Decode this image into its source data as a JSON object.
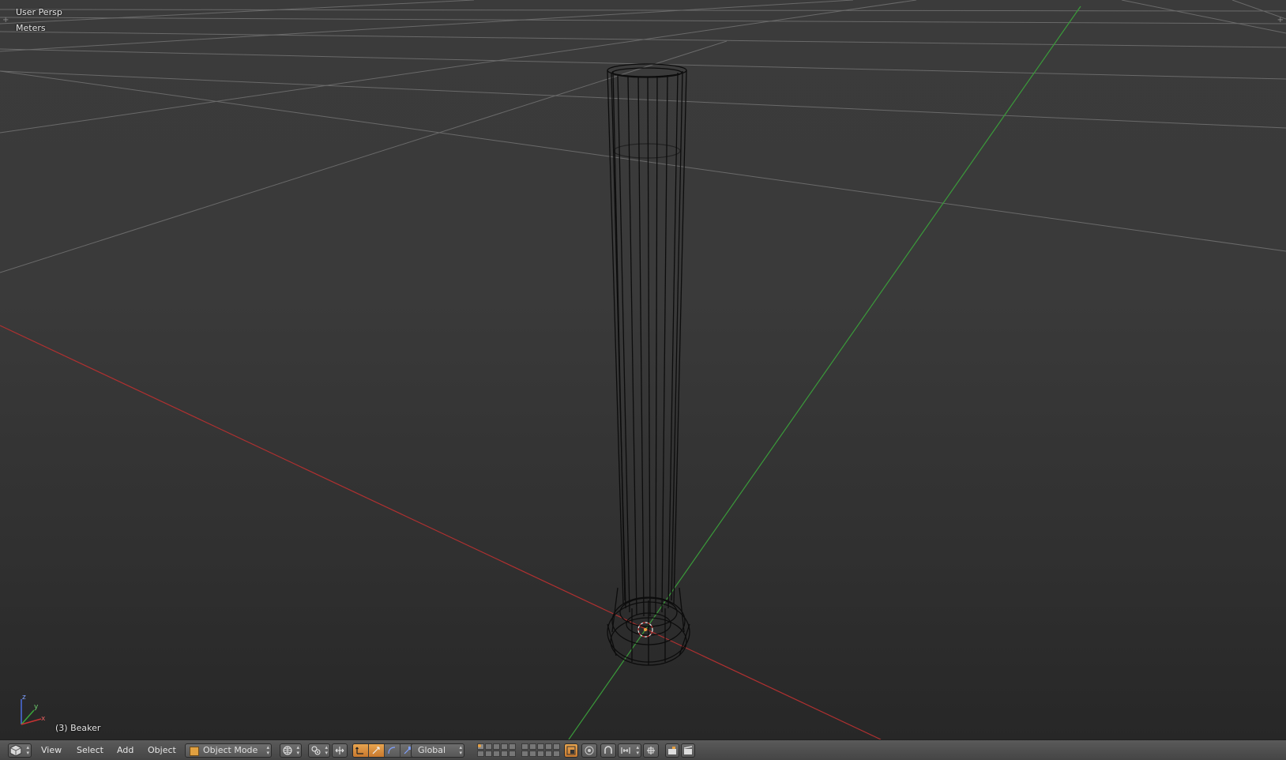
{
  "viewport": {
    "view_name": "User Persp",
    "units": "Meters",
    "active_object": "(3) Beaker",
    "axis_colors": {
      "x": "#b03030",
      "y": "#3a9a3a",
      "grid": "#6a6a6a"
    },
    "gizmo_labels": {
      "x": "x",
      "y": "y",
      "z": "z"
    }
  },
  "header": {
    "editor_type_icon": "cube-icon",
    "menus": [
      "View",
      "Select",
      "Add",
      "Object"
    ],
    "mode": "Object Mode",
    "transform_orientation": "Global",
    "accent_color": "#d88a3c"
  }
}
